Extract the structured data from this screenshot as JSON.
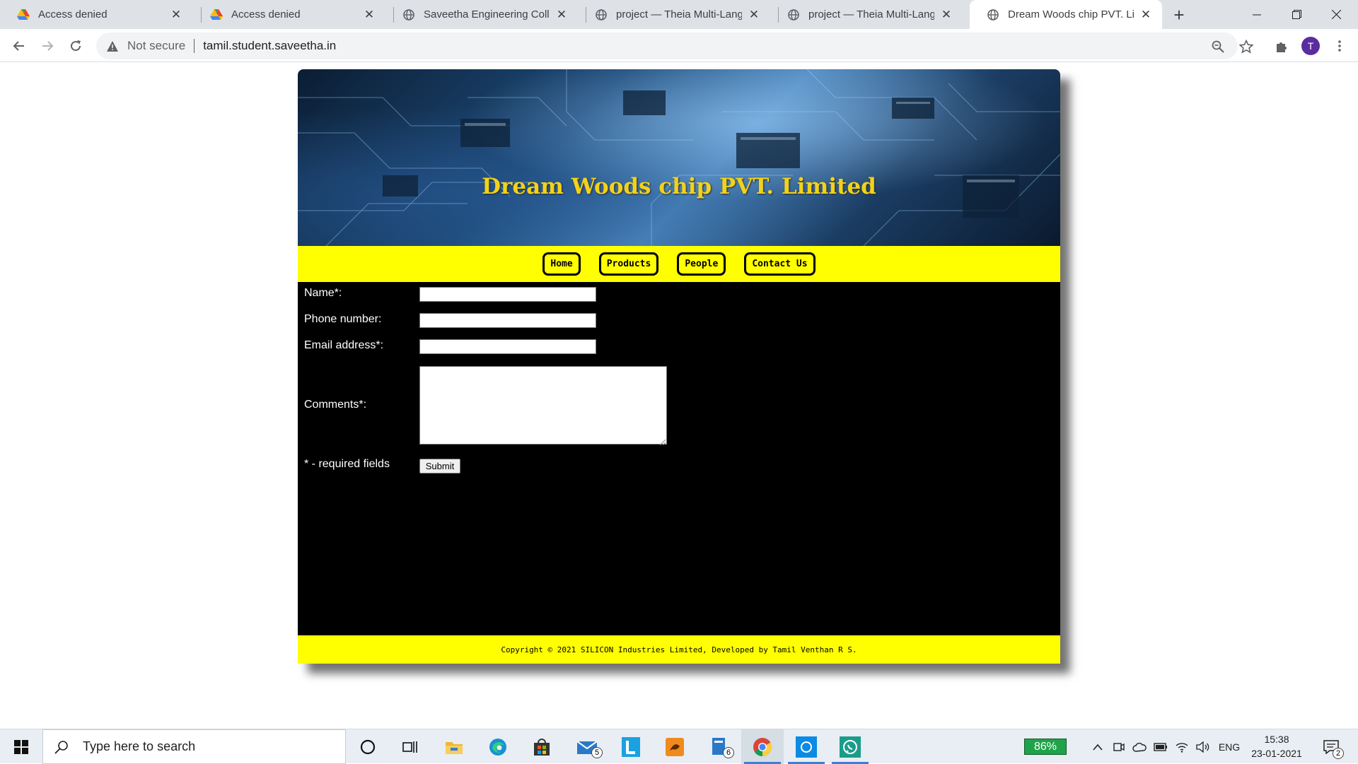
{
  "browser": {
    "tabs": [
      {
        "title": "Access denied",
        "icon": "google-drive-icon",
        "active": false
      },
      {
        "title": "Access denied",
        "icon": "google-drive-icon",
        "active": false
      },
      {
        "title": "Saveetha Engineering College",
        "icon": "globe-icon",
        "active": false
      },
      {
        "title": "project — Theia Multi-Language",
        "icon": "globe-icon",
        "active": false
      },
      {
        "title": "project — Theia Multi-Language",
        "icon": "globe-icon",
        "active": false
      },
      {
        "title": "Dream Woods chip PVT. Limited",
        "icon": "globe-icon",
        "active": true
      }
    ],
    "new_tab_label": "+",
    "omnibox": {
      "security_label": "Not secure",
      "url": "tamil.student.saveetha.in"
    },
    "profile_initial": "T"
  },
  "site": {
    "banner_title": "Dream Woods chip PVT. Limited",
    "nav": [
      {
        "label": "Home"
      },
      {
        "label": "Products"
      },
      {
        "label": "People"
      },
      {
        "label": "Contact Us"
      }
    ],
    "form": {
      "name_label": "Name*:",
      "phone_label": "Phone number:",
      "email_label": "Email address*:",
      "comments_label": "Comments*:",
      "required_note": "* - required fields",
      "submit_label": "Submit"
    },
    "footer_text": "Copyright © 2021 SILICON Industries Limited, Developed by Tamil Venthan R S."
  },
  "taskbar": {
    "search_placeholder": "Type here to search",
    "mail_badge": "5",
    "files_badge": "6",
    "battery_percent": "86%",
    "language": "ENG",
    "time": "15:38",
    "date": "23-01-2021",
    "notification_count": "2"
  },
  "colors": {
    "nav_background": "#ffff00",
    "banner_title": "#f2d21a",
    "form_background": "#000000",
    "profile_avatar": "#5b2ca0",
    "battery_indicator": "#1fa34a"
  }
}
